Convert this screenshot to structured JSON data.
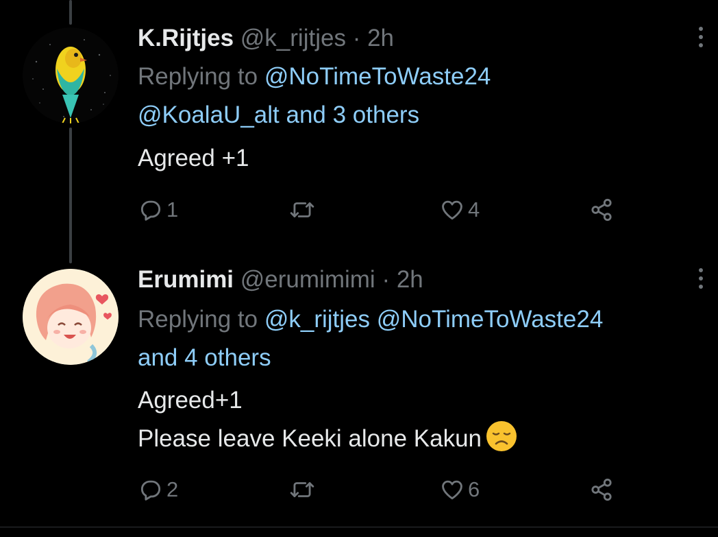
{
  "colors": {
    "background": "#000000",
    "text": "#e7e9ea",
    "muted": "#71767b",
    "mention": "#8ecdf8",
    "thread_line": "#3b3f43"
  },
  "tweets": [
    {
      "display_name": "K.Rijtjes",
      "handle": "@k_rijtjes",
      "separator": "·",
      "time": "2h",
      "replying_prefix": "Replying to",
      "replying_mentions": [
        "@NoTimeToWaste24",
        "@KoalaU_alt"
      ],
      "replying_suffix": "and 3 others",
      "text_lines": [
        "Agreed +1"
      ],
      "avatar_icon": "bird-avatar-icon",
      "more_icon": "more-options-icon",
      "actions": {
        "reply_count": "1",
        "retweet_count": "",
        "like_count": "4"
      }
    },
    {
      "display_name": "Erumimi",
      "handle": "@erumimimi",
      "separator": "·",
      "time": "2h",
      "replying_prefix": "Replying to",
      "replying_mentions": [
        "@k_rijtjes",
        "@NoTimeToWaste24"
      ],
      "replying_suffix": "and 4 others",
      "text_lines": [
        "Agreed+1",
        "Please leave Keeki alone Kakun"
      ],
      "emoji": "disappointed-face-emoji",
      "avatar_icon": "anime-girl-avatar-icon",
      "more_icon": "more-options-icon",
      "actions": {
        "reply_count": "2",
        "retweet_count": "",
        "like_count": "6"
      }
    }
  ]
}
